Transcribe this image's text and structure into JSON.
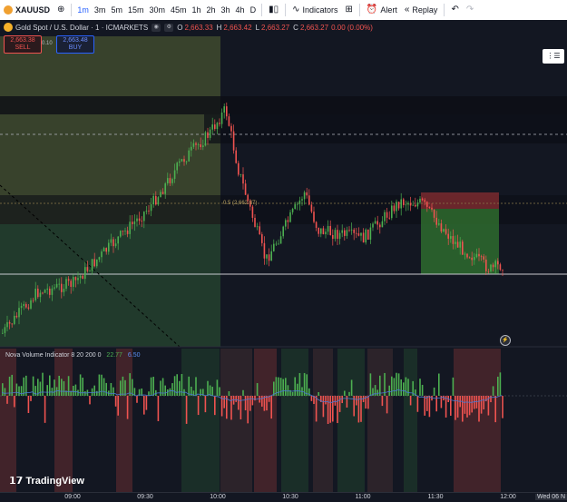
{
  "toolbar": {
    "symbol": "XAUUSD",
    "timeframes": [
      "1m",
      "3m",
      "5m",
      "15m",
      "30m",
      "45m",
      "1h",
      "2h",
      "3h",
      "4h",
      "D"
    ],
    "active_timeframe": "1m",
    "indicators_label": "Indicators",
    "alert_label": "Alert",
    "replay_label": "Replay"
  },
  "header": {
    "title": "Gold Spot / U.S. Dollar · 1 · ICMARKETS",
    "o_label": "O",
    "o_val": "2,663.33",
    "h_label": "H",
    "h_val": "2,663.42",
    "l_label": "L",
    "l_val": "2,663.27",
    "c_label": "C",
    "c_val": "2,663.27",
    "change": "0.00 (0.00%)"
  },
  "trade": {
    "sell_price": "2,663.38",
    "sell_label": "SELL",
    "spread": "0.10",
    "buy_price": "2,663.48",
    "buy_label": "BUY"
  },
  "fib_label": "0.5 (2,662.87)",
  "indicator": {
    "title": "Nova Volume Indicator 8 20 200 0",
    "value1": "22.77",
    "value2": "6.50"
  },
  "time_axis": {
    "labels": [
      "09:00",
      "09:30",
      "10:00",
      "10:30",
      "11:00",
      "11:30",
      "12:00"
    ],
    "date": "Wed 06 N"
  },
  "logo_text": "TradingView",
  "colors": {
    "background": "#131722",
    "up": "#4caf50",
    "down": "#ef5350",
    "accent": "#2962ff"
  }
}
